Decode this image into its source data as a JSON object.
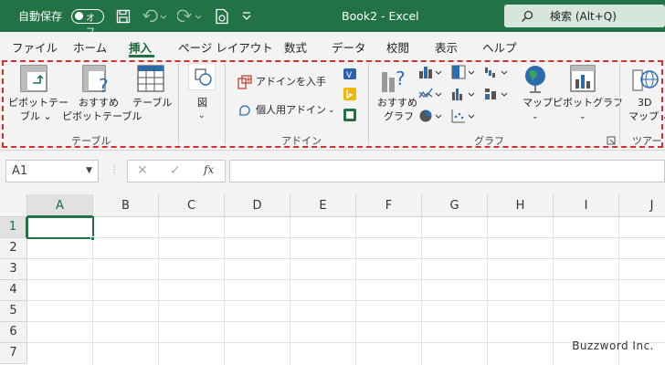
{
  "titlebar": {
    "autosave_label": "自動保存",
    "autosave_state": "オフ",
    "doc_title": "Book2  -  Excel",
    "search_label": "検索 (Alt+Q)"
  },
  "tabs": [
    "ファイル",
    "ホーム",
    "挿入",
    "ページ レイアウト",
    "数式",
    "データ",
    "校閲",
    "表示",
    "ヘルプ"
  ],
  "active_tab": "挿入",
  "ribbon": {
    "pivot_table": [
      "ピボットテー",
      "ブル ⌄"
    ],
    "recommended_pivot": [
      "おすすめ",
      "ピボットテーブル"
    ],
    "table": "テーブル",
    "group_table": "テーブル",
    "illustrations": "図",
    "get_addins": "アドインを入手",
    "my_addins": "個人用アドイン",
    "group_addins": "アドイン",
    "recommended_charts": [
      "おすすめ",
      "グラフ"
    ],
    "maps": "マップ",
    "pivot_chart": "ピボットグラフ",
    "group_charts": "グラフ",
    "map3d": [
      "3D",
      "マップ ⌄"
    ],
    "group_tours": "ツアー"
  },
  "formula": {
    "name_box": "A1",
    "fx": "fx"
  },
  "grid": {
    "columns": [
      "A",
      "B",
      "C",
      "D",
      "E",
      "F",
      "G",
      "H",
      "I",
      "J"
    ],
    "rows": [
      "1",
      "2",
      "3",
      "4",
      "5",
      "6",
      "7"
    ]
  },
  "watermark": "Buzzword Inc.",
  "colors": {
    "excel_green": "#217346",
    "highlight_dash": "#d32f2f"
  }
}
